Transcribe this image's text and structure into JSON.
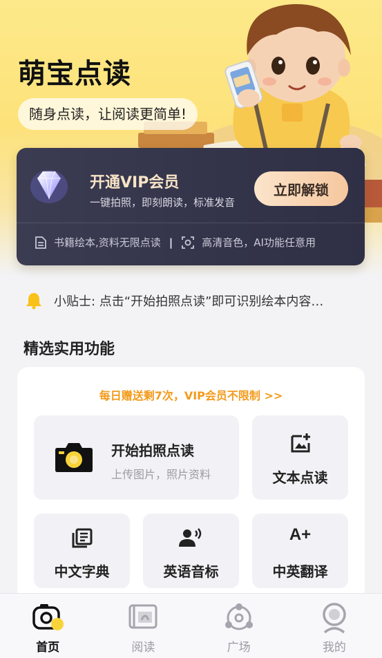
{
  "app": {
    "title": "萌宝点读",
    "slogan": "随身点读，让阅读更简单!"
  },
  "vip": {
    "title": "开通VIP会员",
    "subtitle": "一键拍照，即刻朗读，标准发音",
    "button": "立即解锁",
    "perks": [
      "书籍绘本,资料无限点读",
      "高清音色，AI功能任意用"
    ],
    "separator": "|"
  },
  "tip": {
    "icon": "bell-icon",
    "text": "小贴士: 点击“开始拍照点读”即可识别绘本内容…"
  },
  "features": {
    "section_title": "精选实用功能",
    "quota": "每日赠送剩7次，VIP会员不限制 >>",
    "photo_read": {
      "label": "开始拍照点读",
      "desc": "上传图片，照片资料",
      "icon": "camera-icon"
    },
    "text_read": {
      "label": "文本点读",
      "icon": "image-add-icon"
    },
    "dictionary": {
      "label": "中文字典",
      "icon": "book-stack-icon"
    },
    "phonetic": {
      "label": "英语音标",
      "icon": "speaker-person-icon"
    },
    "translate": {
      "label": "中英翻译",
      "icon": "font-size-icon",
      "glyph": "A+"
    }
  },
  "tabs": [
    {
      "label": "首页",
      "icon": "home-camera-icon",
      "active": true
    },
    {
      "label": "阅读",
      "icon": "reading-icon",
      "active": false
    },
    {
      "label": "广场",
      "icon": "share-icon",
      "active": false
    },
    {
      "label": "我的",
      "icon": "profile-icon",
      "active": false
    }
  ],
  "colors": {
    "accent_yellow": "#fde27a",
    "vip_card": "#3a3b50",
    "vip_title": "#f7e3c6",
    "unlock_button": "#f8d4b1",
    "quota_orange": "#f39a1a"
  }
}
